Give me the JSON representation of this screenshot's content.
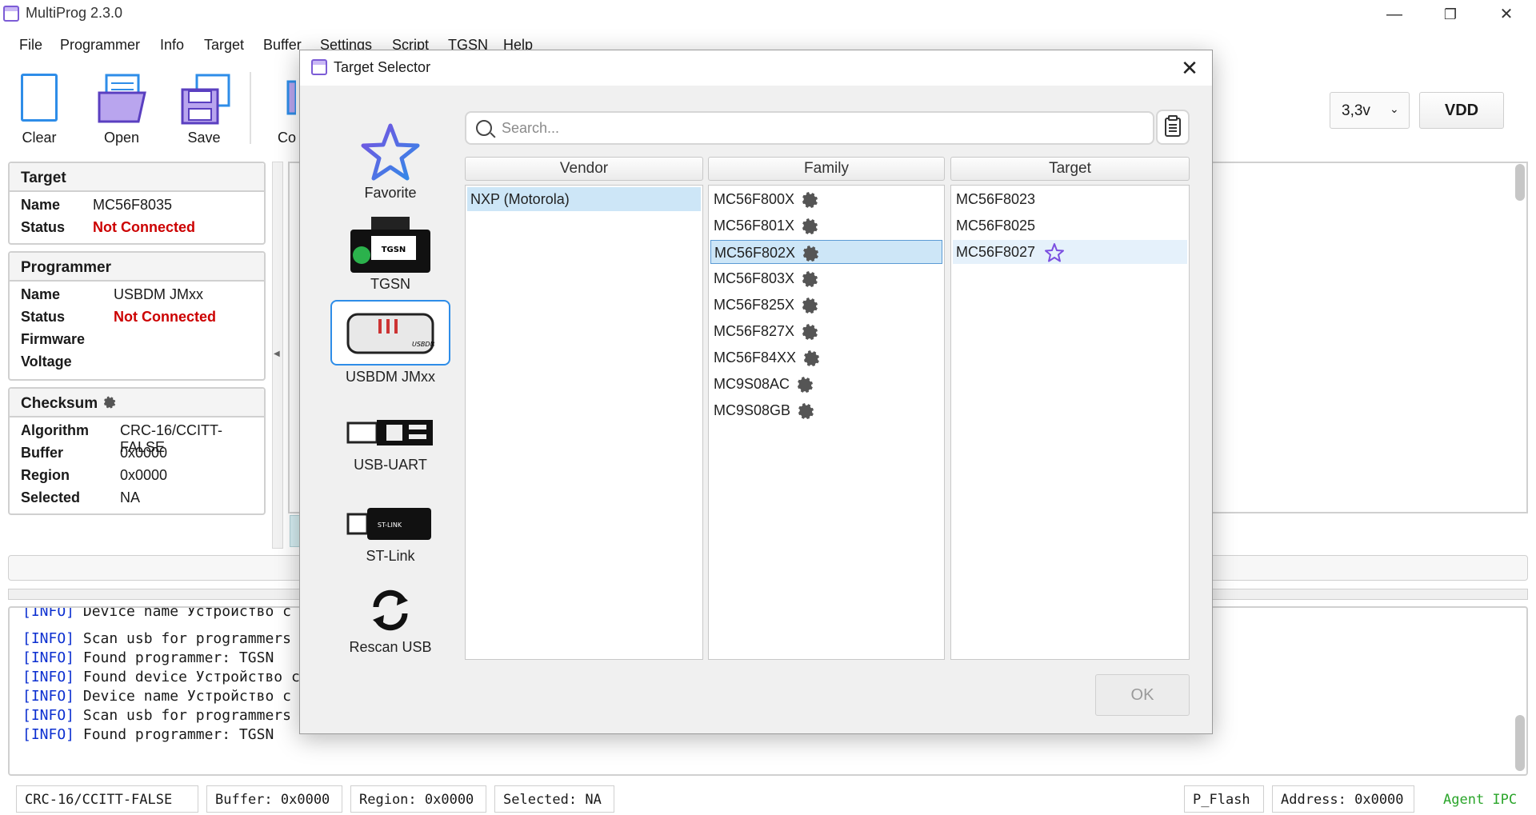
{
  "app": {
    "title": "MultiProg 2.3.0"
  },
  "window_controls": {
    "minimize": "—",
    "restore": "❐",
    "close": "✕"
  },
  "menu": [
    "File",
    "Programmer",
    "Info",
    "Target",
    "Buffer",
    "Settings",
    "Script",
    "TGSN",
    "Help"
  ],
  "toolbar": {
    "clear": "Clear",
    "open": "Open",
    "save": "Save",
    "partial": "Co"
  },
  "voltage": {
    "selected": "3,3v",
    "vdd_label": "VDD"
  },
  "target_panel": {
    "header": "Target",
    "name_label": "Name",
    "name_value": "MC56F8035",
    "status_label": "Status",
    "status_value": "Not Connected"
  },
  "programmer_panel": {
    "header": "Programmer",
    "name_label": "Name",
    "name_value": "USBDM JMxx",
    "status_label": "Status",
    "status_value": "Not Connected",
    "firmware_label": "Firmware",
    "voltage_label": "Voltage"
  },
  "checksum_panel": {
    "header": "Checksum",
    "algorithm_label": "Algorithm",
    "algorithm_value": "CRC-16/CCITT-FALSE",
    "buffer_label": "Buffer",
    "buffer_value": "0x0000",
    "region_label": "Region",
    "region_value": "0x0000",
    "selected_label": "Selected",
    "selected_value": "NA"
  },
  "log": [
    {
      "tag": "[INFO]",
      "text": " Device name Устройство с п"
    },
    {
      "tag": "[INFO]",
      "text": " Scan usb for programmers"
    },
    {
      "tag": "[INFO]",
      "text": " Found programmer: TGSN"
    },
    {
      "tag": "[INFO]",
      "text": " Found device Устройство с"
    },
    {
      "tag": "[INFO]",
      "text": " Device name Устройство с п"
    },
    {
      "tag": "[INFO]",
      "text": " Scan usb for programmers"
    },
    {
      "tag": "[INFO]",
      "text": " Found programmer: TGSN"
    }
  ],
  "statusbar": {
    "algorithm": "CRC-16/CCITT-FALSE",
    "buffer": "Buffer: 0x0000",
    "region": "Region: 0x0000",
    "selected": "Selected: NA",
    "memory": "P_Flash",
    "address": "Address: 0x0000",
    "agent": "Agent IPC"
  },
  "dialog": {
    "title": "Target Selector",
    "search_placeholder": "Search...",
    "programmers": [
      "Favorite",
      "TGSN",
      "USBDM JMxx",
      "USB-UART",
      "ST-Link",
      "Rescan USB"
    ],
    "columns": {
      "vendor": "Vendor",
      "family": "Family",
      "target": "Target"
    },
    "vendors": [
      "NXP (Motorola)"
    ],
    "families": [
      "MC56F800X",
      "MC56F801X",
      "MC56F802X",
      "MC56F803X",
      "MC56F825X",
      "MC56F827X",
      "MC56F84XX",
      "MC9S08AC",
      "MC9S08GB"
    ],
    "targets": [
      "MC56F8023",
      "MC56F8025",
      "MC56F8027"
    ],
    "ok_label": "OK"
  },
  "colors": {
    "accent": "#2e8de8",
    "error": "#cc0000",
    "log_tag": "#0b2fd0",
    "agent": "#2aa52a",
    "favorite": "#7b4fe0"
  }
}
